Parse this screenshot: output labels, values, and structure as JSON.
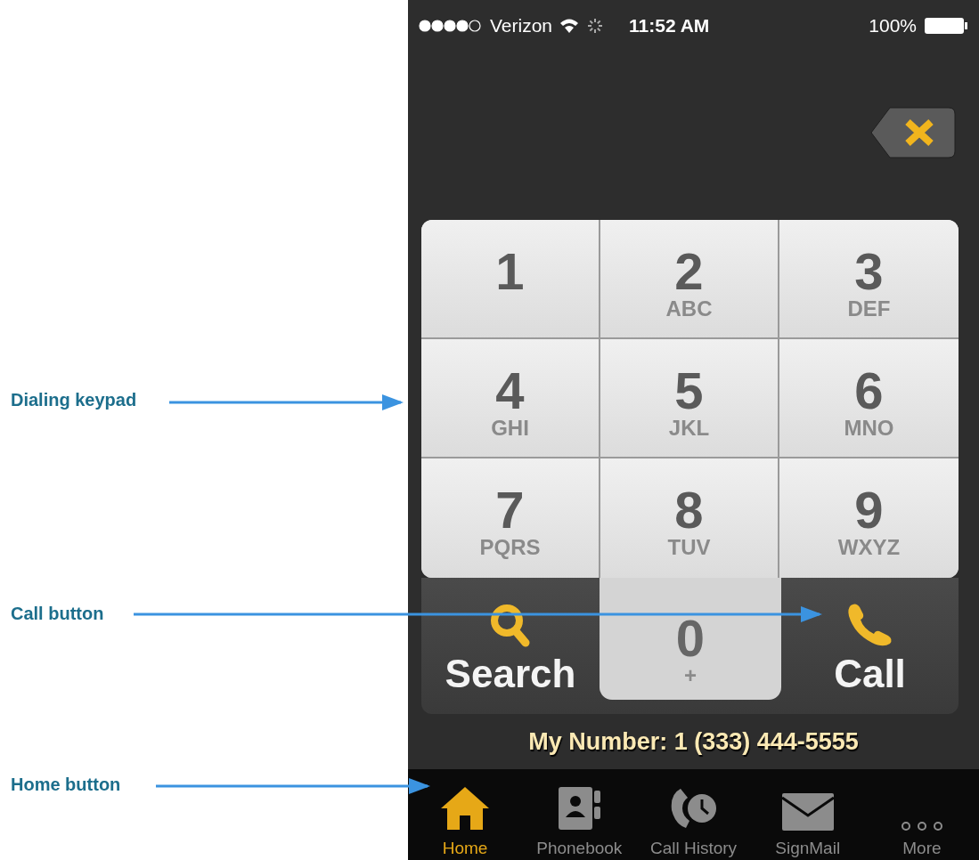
{
  "annotations": [
    {
      "label": "Dialing keypad"
    },
    {
      "label": "Call button"
    },
    {
      "label": "Home button"
    }
  ],
  "status_bar": {
    "carrier": "Verizon",
    "time": "11:52 AM",
    "battery": "100%"
  },
  "keypad": {
    "keys": [
      {
        "digit": "1"
      },
      {
        "digit": "2",
        "letters": "ABC"
      },
      {
        "digit": "3",
        "letters": "DEF"
      },
      {
        "digit": "4",
        "letters": "GHI"
      },
      {
        "digit": "5",
        "letters": "JKL"
      },
      {
        "digit": "6",
        "letters": "MNO"
      },
      {
        "digit": "7",
        "letters": "PQRS"
      },
      {
        "digit": "8",
        "letters": "TUV"
      },
      {
        "digit": "9",
        "letters": "WXYZ"
      }
    ]
  },
  "actions": [
    {
      "kind": "search",
      "label": "Search"
    },
    {
      "kind": "zero",
      "digit": "0",
      "letters": "+"
    },
    {
      "kind": "call",
      "label": "Call"
    }
  ],
  "my_number": "My Number: 1 (333) 444-5555",
  "tab_bar": [
    {
      "kind": "home",
      "label": "Home",
      "selected": true
    },
    {
      "kind": "phonebook",
      "label": "Phonebook",
      "selected": false
    },
    {
      "kind": "history",
      "label": "Call History",
      "selected": false
    },
    {
      "kind": "signmail",
      "label": "SignMail",
      "selected": false
    },
    {
      "kind": "more",
      "label": "More",
      "selected": false
    }
  ]
}
